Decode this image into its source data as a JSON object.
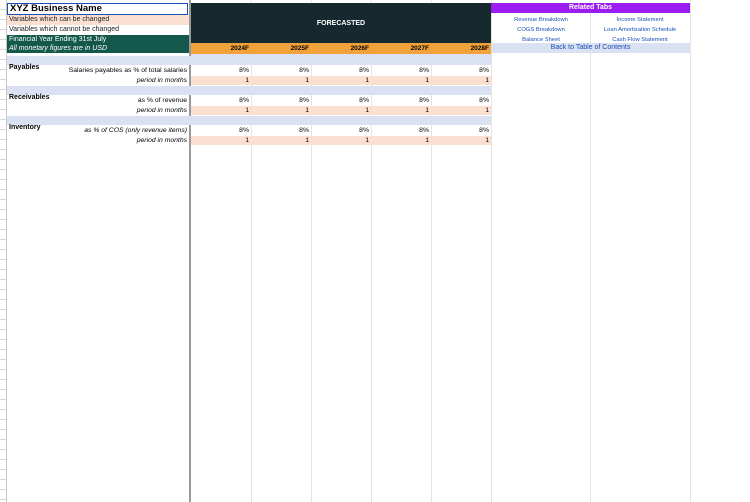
{
  "header": {
    "business_name": "XYZ Business Name",
    "legend_changeable": "Variables which can be changed",
    "legend_fixed": "Variables which cannot be changed",
    "fiscal_year": "Financial Year Ending 31st July",
    "currency_note": "All monetary figures are in USD"
  },
  "forecast": {
    "label": "FORECASTED",
    "years": [
      "2024F",
      "2025F",
      "2026F",
      "2027F",
      "2028F"
    ]
  },
  "related": {
    "title": "Related Tabs",
    "links_left": [
      "Revenue Breakdown",
      "COGS Breakdown",
      "Balance Sheet"
    ],
    "links_right": [
      "Income Statement",
      "Loan Amortization Schedule",
      "Cash Flow Statement"
    ],
    "back": "Back to Table of Contents"
  },
  "sections": [
    {
      "title": "Payables",
      "rows": [
        {
          "label": "Salaries payables as % of total salaries",
          "values": [
            "8%",
            "8%",
            "8%",
            "8%",
            "8%"
          ]
        },
        {
          "label": "period in months",
          "values": [
            "1",
            "1",
            "1",
            "1",
            "1"
          ]
        }
      ]
    },
    {
      "title": "Receivables",
      "rows": [
        {
          "label": "as % of revenue",
          "values": [
            "8%",
            "8%",
            "8%",
            "8%",
            "8%"
          ]
        },
        {
          "label": "period in months",
          "values": [
            "1",
            "1",
            "1",
            "1",
            "1"
          ]
        }
      ]
    },
    {
      "title": "Inventory",
      "rows": [
        {
          "label": "as % of COS (only revenue items)",
          "values": [
            "8%",
            "8%",
            "8%",
            "8%",
            "8%"
          ]
        },
        {
          "label": "period in months",
          "values": [
            "1",
            "1",
            "1",
            "1",
            "1"
          ]
        }
      ]
    }
  ],
  "colors": {
    "frozen_header": "#16292e",
    "year_band": "#f2a23a",
    "section_band": "#d9e1f2",
    "editable_fill": "#fbe0d2",
    "related_header": "#9b1cf0",
    "dark_green": "#14584c"
  }
}
